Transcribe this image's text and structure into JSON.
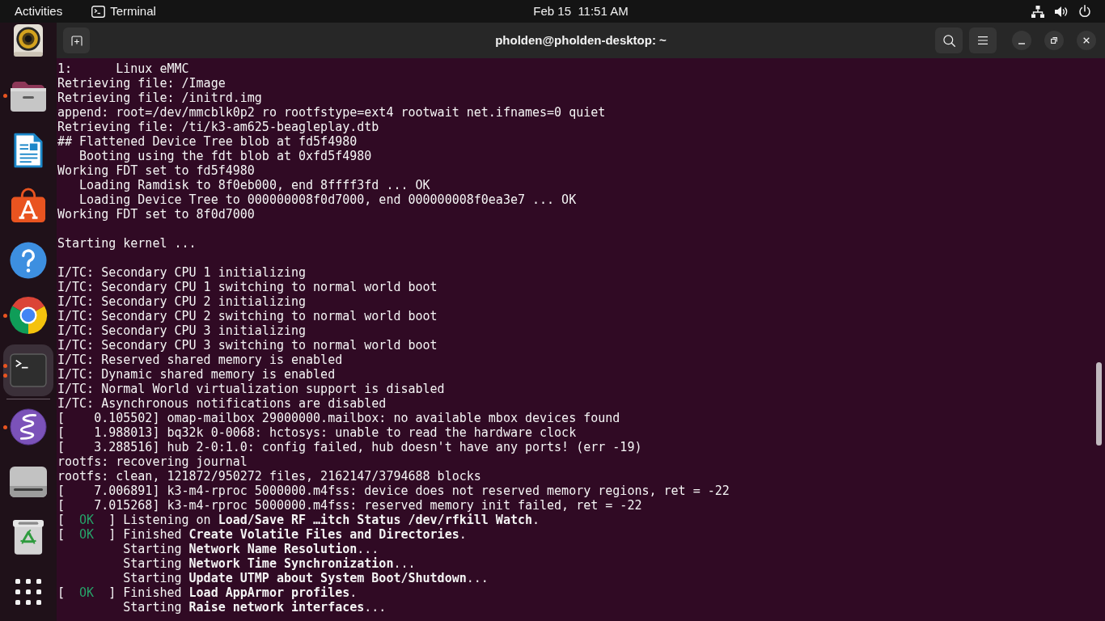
{
  "top_bar": {
    "activities": "Activities",
    "app_menu": "Terminal",
    "clock": "Feb 15  11:51 AM"
  },
  "dock": {
    "favorites": [
      {
        "kind": "music",
        "running": false,
        "several_windows": false,
        "selected": false
      },
      {
        "kind": "files",
        "running": true,
        "several_windows": false,
        "selected": false
      },
      {
        "kind": "writer",
        "running": false,
        "several_windows": false,
        "selected": false
      },
      {
        "kind": "store",
        "running": false,
        "several_windows": false,
        "selected": false
      },
      {
        "kind": "help",
        "running": false,
        "several_windows": false,
        "selected": false
      },
      {
        "kind": "browser",
        "running": true,
        "several_windows": false,
        "selected": false
      },
      {
        "kind": "terminal",
        "running": true,
        "several_windows": true,
        "selected": true
      }
    ],
    "others": [
      {
        "kind": "editor",
        "running": true,
        "several_windows": false,
        "selected": false
      },
      {
        "kind": "drive",
        "running": false,
        "several_windows": false,
        "selected": false
      },
      {
        "kind": "trash",
        "running": false,
        "several_windows": false,
        "selected": false
      }
    ]
  },
  "terminal": {
    "title": "pholden@pholden-desktop: ~",
    "lines": [
      {
        "kind": "text",
        "text": "1:      Linux eMMC"
      },
      {
        "kind": "text",
        "text": "Retrieving file: /Image"
      },
      {
        "kind": "text",
        "text": "Retrieving file: /initrd.img"
      },
      {
        "kind": "text",
        "text": "append: root=/dev/mmcblk0p2 ro rootfstype=ext4 rootwait net.ifnames=0 quiet"
      },
      {
        "kind": "text",
        "text": "Retrieving file: /ti/k3-am625-beagleplay.dtb"
      },
      {
        "kind": "text",
        "text": "## Flattened Device Tree blob at fd5f4980"
      },
      {
        "kind": "text",
        "text": "   Booting using the fdt blob at 0xfd5f4980"
      },
      {
        "kind": "text",
        "text": "Working FDT set to fd5f4980"
      },
      {
        "kind": "text",
        "text": "   Loading Ramdisk to 8f0eb000, end 8ffff3fd ... OK"
      },
      {
        "kind": "text",
        "text": "   Loading Device Tree to 000000008f0d7000, end 000000008f0ea3e7 ... OK"
      },
      {
        "kind": "text",
        "text": "Working FDT set to 8f0d7000"
      },
      {
        "kind": "blank"
      },
      {
        "kind": "text",
        "text": "Starting kernel ..."
      },
      {
        "kind": "blank"
      },
      {
        "kind": "text",
        "text": "I/TC: Secondary CPU 1 initializing"
      },
      {
        "kind": "text",
        "text": "I/TC: Secondary CPU 1 switching to normal world boot"
      },
      {
        "kind": "text",
        "text": "I/TC: Secondary CPU 2 initializing"
      },
      {
        "kind": "text",
        "text": "I/TC: Secondary CPU 2 switching to normal world boot"
      },
      {
        "kind": "text",
        "text": "I/TC: Secondary CPU 3 initializing"
      },
      {
        "kind": "text",
        "text": "I/TC: Secondary CPU 3 switching to normal world boot"
      },
      {
        "kind": "text",
        "text": "I/TC: Reserved shared memory is enabled"
      },
      {
        "kind": "text",
        "text": "I/TC: Dynamic shared memory is enabled"
      },
      {
        "kind": "text",
        "text": "I/TC: Normal World virtualization support is disabled"
      },
      {
        "kind": "text",
        "text": "I/TC: Asynchronous notifications are disabled"
      },
      {
        "kind": "text",
        "text": "[    0.105502] omap-mailbox 29000000.mailbox: no available mbox devices found"
      },
      {
        "kind": "text",
        "text": "[    1.988013] bq32k 0-0068: hctosys: unable to read the hardware clock"
      },
      {
        "kind": "text",
        "text": "[    3.288516] hub 2-0:1.0: config failed, hub doesn't have any ports! (err -19)"
      },
      {
        "kind": "text",
        "text": "rootfs: recovering journal"
      },
      {
        "kind": "text",
        "text": "rootfs: clean, 121872/950272 files, 2162147/3794688 blocks"
      },
      {
        "kind": "text",
        "text": "[    7.006891] k3-m4-rproc 5000000.m4fss: device does not reserved memory regions, ret = -22"
      },
      {
        "kind": "text",
        "text": "[    7.015268] k3-m4-rproc 5000000.m4fss: reserved memory init failed, ret = -22"
      },
      {
        "kind": "status",
        "lead": "[  ",
        "status": "OK",
        "trail": "  ] ",
        "message": "Listening on **Load/Save RF …itch Status /dev/rfkill Watch**."
      },
      {
        "kind": "status",
        "lead": "[  ",
        "status": "OK",
        "trail": "  ] ",
        "message": "Finished **Create Volatile Files and Directories**."
      },
      {
        "kind": "text",
        "text": "         Starting **Network Name Resolution**..."
      },
      {
        "kind": "text",
        "text": "         Starting **Network Time Synchronization**..."
      },
      {
        "kind": "text",
        "text": "         Starting **Update UTMP about System Boot/Shutdown**..."
      },
      {
        "kind": "status",
        "lead": "[  ",
        "status": "OK",
        "trail": "  ] ",
        "message": "Finished **Load AppArmor profiles**."
      },
      {
        "kind": "text",
        "text": "         Starting **Raise network interfaces**..."
      }
    ]
  }
}
